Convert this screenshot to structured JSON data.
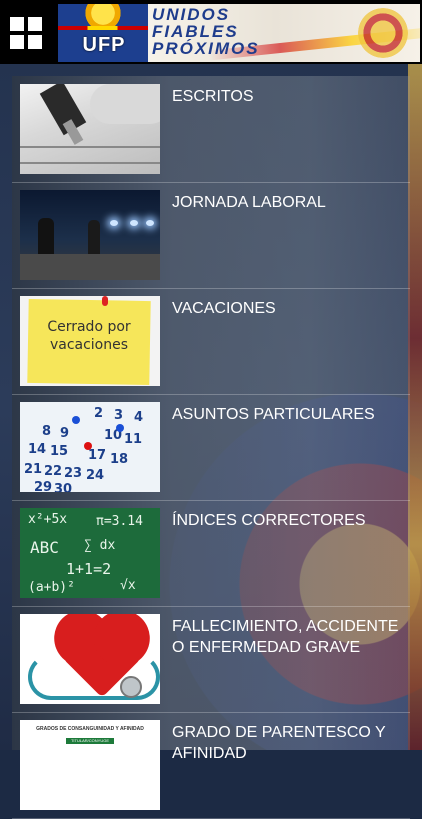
{
  "header": {
    "menu_icon": "grid-menu-icon",
    "banner": {
      "logo_text": "UFP",
      "line1": "UNIDOS",
      "line2": "FIABLES",
      "line3": "PRÓXIMOS",
      "colors": {
        "blue": "#1e3c8c",
        "red": "#c41a1a",
        "yellow": "#ffd800"
      }
    }
  },
  "items": [
    {
      "title": "ESCRITOS",
      "thumb": "pen-writing-image"
    },
    {
      "title": "JORNADA LABORAL",
      "thumb": "night-police-image"
    },
    {
      "title": "VACACIONES",
      "thumb": "closed-for-vacation-image",
      "thumb_text": "Cerrado por vacaciones"
    },
    {
      "title": "ASUNTOS PARTICULARES",
      "thumb": "calendar-image"
    },
    {
      "title": "ÍNDICES CORRECTORES",
      "thumb": "chalkboard-math-image"
    },
    {
      "title": "FALLECIMIENTO, ACCIDENTE O ENFERMEDAD GRAVE",
      "thumb": "heart-stethoscope-image"
    },
    {
      "title": "GRADO DE PARENTESCO Y AFINIDAD",
      "thumb": "kinship-chart-image",
      "thumb_text": "GRADOS DE CONSANGUINIDAD Y AFINIDAD",
      "thumb_sub": "TITULAR/CONYUGE"
    }
  ]
}
